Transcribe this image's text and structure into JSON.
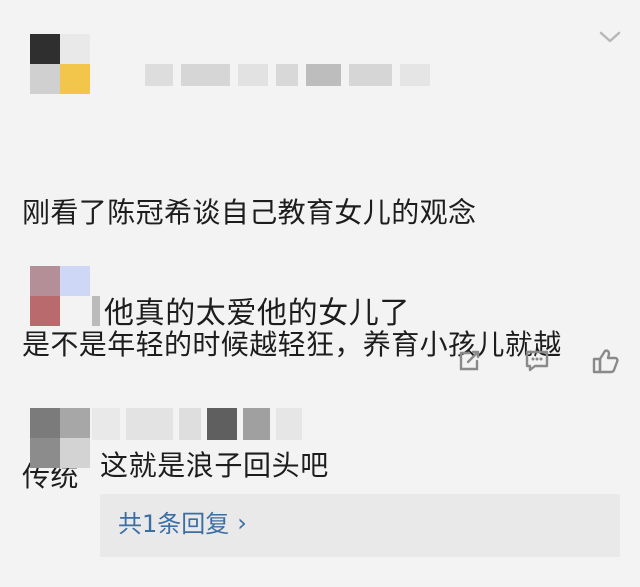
{
  "post": {
    "line1": "刚看了陈冠希谈自己教育女儿的观念",
    "line2": "是不是年轻的时候越轻狂，养育小孩儿就越",
    "line3": "传统"
  },
  "comments": [
    {
      "text": "他真的太爱他的女儿了"
    },
    {
      "text": "这就是浪子回头吧",
      "replies_label": "共1条回复",
      "replies_arrow": "›"
    }
  ],
  "icons": {
    "share": "share-icon",
    "comment": "comment-icon",
    "like": "thumbs-up-icon",
    "chevron": "chevron-down-icon"
  },
  "colors": {
    "background": "#f3f3f3",
    "text": "#1d1d1d",
    "link": "#3c6ea3"
  }
}
